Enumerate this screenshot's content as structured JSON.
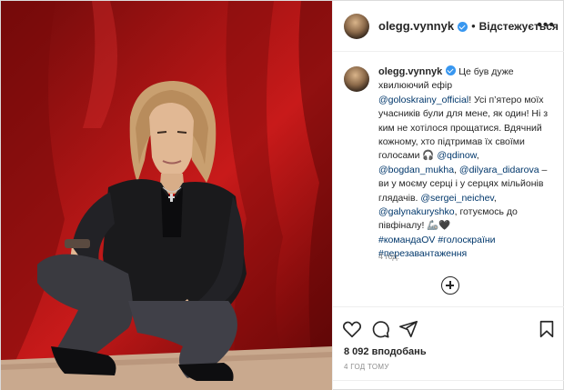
{
  "post": {
    "username": "olegg.vynnyk",
    "follow_status": "Відстежується",
    "separator": "•",
    "more_icon": "more-options-icon",
    "caption": {
      "intro": "Це був дуже хвилюючий ефір",
      "mention_main": "@golоskrainy_official",
      "text1": "! Усі п’ятеро моїх учасників були для мене, як один! Ні з ким не хотілося прощатися. Вдячний кожному, хто підтримав їх своїми голосами 🎧 ",
      "mention_1": "@qdinow",
      "sep1": ",",
      "mention_2": "@bogdan_mukha",
      "sep2": ", ",
      "mention_3": "@dilyara_didarova",
      "text2": " – ви у моєму серці і у серцях мільйонів глядачів. ",
      "mention_4": "@sergei_neichev",
      "sep3": ",",
      "mention_5": "@galynakuryshko",
      "text3": ", готуємось до півфіналу! 🦾🖤",
      "hashtag_1": "#командаOV",
      "hashtag_2": "#голоскраїни",
      "hashtag_3": "#перезавантаження"
    },
    "caption_time": "4 год.",
    "likes": "8 092 вподобань",
    "time_ago": "4 ГОД ТОМУ"
  },
  "colors": {
    "link": "#00376b",
    "verified": "#3897f0",
    "backdrop": "#c81a1a"
  }
}
